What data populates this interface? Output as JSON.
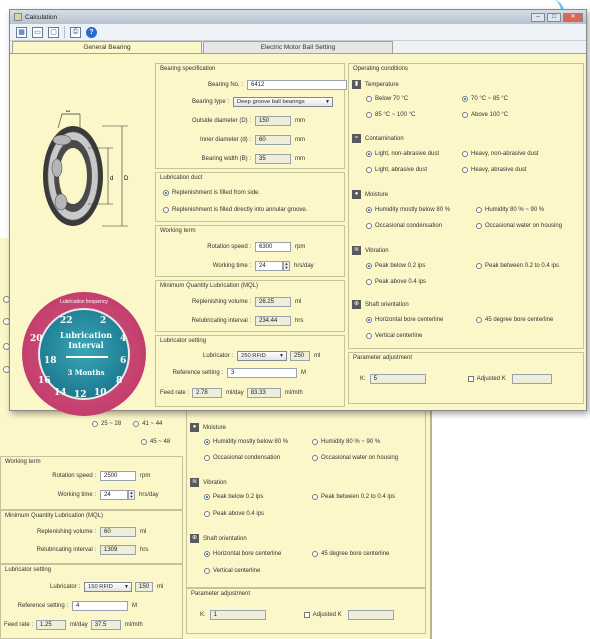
{
  "window": {
    "title": "Calculation"
  },
  "tabs": [
    "General Bearing",
    "Electric Motor Ball Setting"
  ],
  "bearing_spec": {
    "header": "Bearing specification",
    "bearing_no_label": "Bearing No. :",
    "bearing_no": "6412",
    "bearing_type_label": "Bearing type :",
    "bearing_type": "Deep groove ball bearings",
    "outside_label": "Outside diameter (D) :",
    "outside": "150",
    "inner_label": "Inner diameter (d) :",
    "inner": "60",
    "width_label": "Bearing width (B) :",
    "width": "35",
    "unit": "mm"
  },
  "drawing_labels": {
    "b": "B",
    "d_out": "D",
    "d_in": "d"
  },
  "lubrication_duct": {
    "header": "Lubrication duct",
    "opt1": "Replenishment is filled from side.",
    "opt2": "Replenishment is filled directly into annular groove."
  },
  "working_term": {
    "header": "Working term",
    "rotation_label": "Rotation speed :",
    "rotation": "6300",
    "rotation_unit": "rpm",
    "time_label": "Working time :",
    "time": "24",
    "time_unit": "hrs/day"
  },
  "mql": {
    "header": "Minimum Quantity Lubrication (MQL)",
    "replenish_label": "Replenishing volume :",
    "replenish": "26.25",
    "replenish_unit": "ml",
    "interval_label": "Relubricating interval :",
    "interval": "234.44",
    "interval_unit": "hrs"
  },
  "lubricator": {
    "header": "Lubricator setting",
    "lub_label": "Lubricator :",
    "lub": "250 RFID",
    "lub_size": "250",
    "lub_unit": "ml",
    "ref_label": "Reference setting :",
    "ref": "3",
    "ref_unit": "M",
    "feed_label": "Feed rate :",
    "feed_day": "2.78",
    "feed_day_unit": "ml/day",
    "feed_mth": "83.33",
    "feed_mth_unit": "ml/mth"
  },
  "operating": {
    "header": "Operating conditions",
    "temp": {
      "title": "Temperature",
      "o1": "Below 70 °C",
      "o2": "70 °C ~ 85 °C",
      "o3": "85 °C ~ 100 °C",
      "o4": "Above 100 °C"
    },
    "contam": {
      "title": "Contamination",
      "o1": "Light, non-abrasive dust",
      "o2": "Heavy, non-abrasive dust",
      "o3": "Light, abrasive dust",
      "o4": "Heavy, abrasive dust"
    },
    "moist": {
      "title": "Moisture",
      "o1": "Humidity mostly below 80 %",
      "o2": "Humidity 80 % ~ 90 %",
      "o3": "Occasional condensation",
      "o4": "Occasional water on housing"
    },
    "vib": {
      "title": "Vibration",
      "o1": "Peak below 0.2 ips",
      "o2": "Peak between 0.2 to 0.4 ips",
      "o3": "Peak above 0.4 ips"
    },
    "shaft": {
      "title": "Shaft orientation",
      "o1": "Horizontal bore centerline",
      "o2": "45 degree bore centerline",
      "o3": "Vertical centerline"
    }
  },
  "param": {
    "header": "Parameter adjustment",
    "k_label": "K:",
    "k": "5",
    "adj_label": "Adjusted K"
  },
  "dial": {
    "title": "Lubrication frequency",
    "line1": "Lubrication",
    "line2": "Interval",
    "months": "3 Months",
    "n22": "22",
    "n2": "2",
    "n20": "20",
    "n4": "4",
    "n18": "18",
    "n6": "6",
    "n16": "16",
    "n8": "8",
    "n14": "14",
    "n12": "12",
    "n10": "10"
  },
  "back": {
    "ranges": {
      "r1": "25 ~ 28",
      "r2": "41 ~ 44",
      "r3": "45 ~ 48"
    },
    "working_term": {
      "header": "Working term",
      "rotation_label": "Rotation speed :",
      "rotation": "2500",
      "rotation_unit": "rpm",
      "time_label": "Working time :",
      "time": "24",
      "time_unit": "hrs/day"
    },
    "mql": {
      "header": "Minimum Quantity Lubrication (MQL)",
      "replenish_label": "Replenishing volume :",
      "replenish": "60",
      "replenish_unit": "ml",
      "interval_label": "Relubricating interval :",
      "interval": "1309",
      "interval_unit": "hrs"
    },
    "lubricator": {
      "header": "Lubricator setting",
      "lub_label": "Lubricator :",
      "lub": "150 RFID",
      "lub_size": "150",
      "lub_unit": "ml",
      "ref_label": "Reference setting :",
      "ref": "4",
      "ref_unit": "M",
      "feed_label": "Feed rate :",
      "feed_day": "1.25",
      "feed_day_unit": "ml/day",
      "feed_mth": "37.5",
      "feed_mth_unit": "ml/mth"
    },
    "moist": {
      "title": "Moisture",
      "o1": "Humidity mostly below 80 %",
      "o2": "Humidity 80 % ~ 90 %",
      "o3": "Occasional condensation",
      "o4": "Occasional water on housing"
    },
    "vib": {
      "title": "Vibration",
      "o1": "Peak below 0.2 ips",
      "o2": "Peak between 0.2 to 0.4 ips",
      "o3": "Peak above 0.4 ips"
    },
    "shaft": {
      "title": "Shaft orientation",
      "o1": "Horizontal bore centerline",
      "o2": "45 degree bore centerline",
      "o3": "Vertical centerline"
    },
    "param": {
      "header": "Parameter adjustment",
      "k_label": "K:",
      "k": "1",
      "adj_label": "Adjusted K"
    }
  }
}
